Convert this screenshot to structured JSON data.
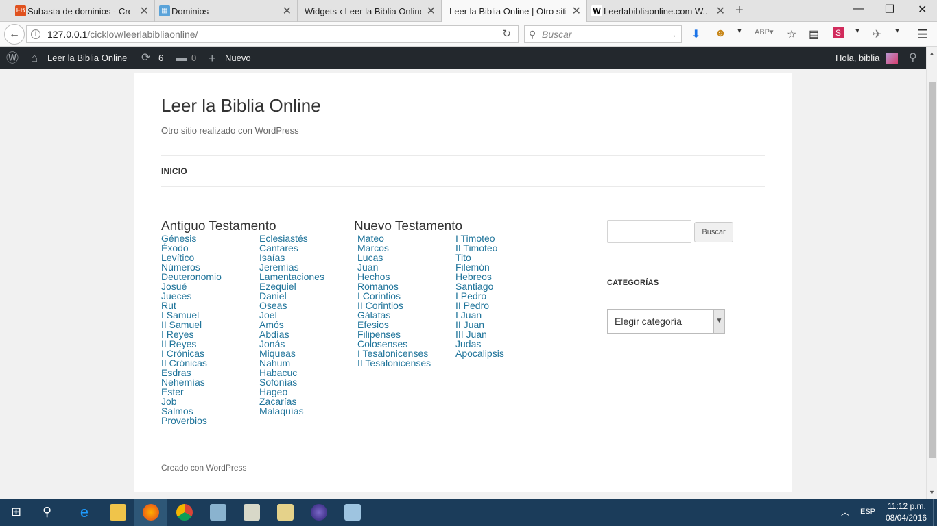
{
  "browser": {
    "tabs": [
      {
        "label": "Subasta de dominios - Cre...",
        "active": false
      },
      {
        "label": "Dominios",
        "active": false
      },
      {
        "label": "Widgets ‹ Leer la Biblia Online ...",
        "active": false
      },
      {
        "label": "Leer la Biblia Online | Otro siti...",
        "active": true
      },
      {
        "label": "Leerlabibliaonline.com W...",
        "active": false
      }
    ],
    "url_host": "127.0.0.1",
    "url_path": "/cicklow/leerlabibliaonline/",
    "search_placeholder": "Buscar"
  },
  "adminbar": {
    "site_name": "Leer la Biblia Online",
    "updates_count": "6",
    "comments_count": "0",
    "new_label": "Nuevo",
    "greeting": "Hola, biblia"
  },
  "site": {
    "title": "Leer la Biblia Online",
    "description": "Otro sitio realizado con WordPress",
    "menu": [
      "INICIO"
    ],
    "footer": "Creado con WordPress"
  },
  "content": {
    "old_testament": {
      "title": "Antiguo Testamento",
      "col1": [
        "Génesis",
        "Éxodo",
        "Levítico",
        "Números",
        "Deuteronomio",
        "Josué",
        "Jueces",
        "Rut",
        "I Samuel",
        "II Samuel",
        "I Reyes",
        "II Reyes",
        "I Crónicas",
        "II Crónicas",
        "Esdras",
        "Nehemías",
        "Ester",
        "Job",
        "Salmos",
        "Proverbios"
      ],
      "col2": [
        "Eclesiastés",
        "Cantares",
        "Isaías",
        "Jeremías",
        "Lamentaciones",
        "Ezequiel",
        "Daniel",
        "Oseas",
        "Joel",
        "Amós",
        "Abdías",
        "Jonás",
        "Miqueas",
        "Nahum",
        "Habacuc",
        "Sofonías",
        "Hageo",
        "Zacarías",
        "Malaquías"
      ]
    },
    "new_testament": {
      "title": "Nuevo Testamento",
      "col1": [
        "Mateo",
        "Marcos",
        "Lucas",
        "Juan",
        "Hechos",
        "Romanos",
        "I Corintios",
        "II Corintios",
        "Gálatas",
        "Efesios",
        "Filipenses",
        "Colosenses",
        "I Tesalonicenses",
        "II Tesalonicenses"
      ],
      "col2": [
        "I Timoteo",
        "II Timoteo",
        "Tito",
        "Filemón",
        "Hebreos",
        "Santiago",
        "I Pedro",
        "II Pedro",
        "I Juan",
        "II Juan",
        "III Juan",
        "Judas",
        "Apocalipsis"
      ]
    }
  },
  "sidebar": {
    "search_button": "Buscar",
    "categories_title": "CATEGORÍAS",
    "categories_select": "Elegir categoría"
  },
  "taskbar": {
    "language": "ESP",
    "time": "11:12 p.m.",
    "date": "08/04/2016"
  },
  "colors": {
    "link": "#21759b",
    "adminbar_bg": "#23282d",
    "taskbar_bg": "#1b3c5a"
  }
}
